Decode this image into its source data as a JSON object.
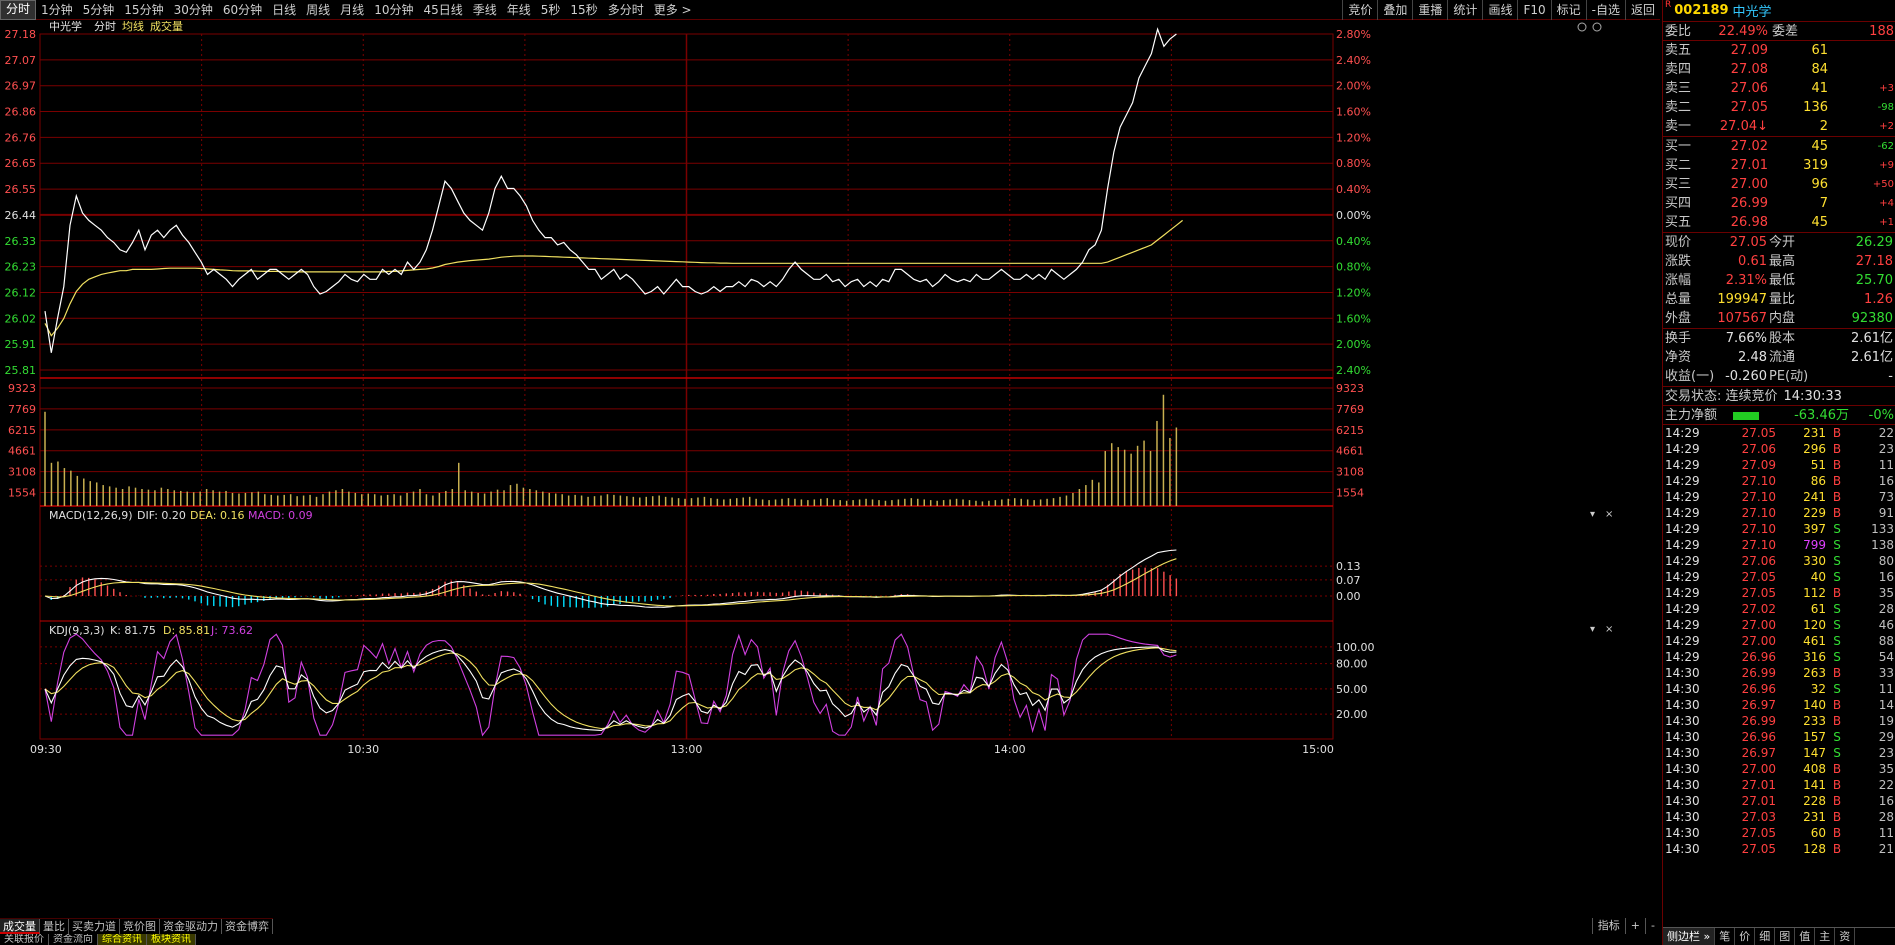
{
  "topbar": {
    "tabs": [
      "分时",
      "1分钟",
      "5分钟",
      "15分钟",
      "30分钟",
      "60分钟",
      "日线",
      "周线",
      "月线",
      "10分钟",
      "45日线",
      "季线",
      "年线",
      "5秒",
      "15秒",
      "多分时",
      "更多 >"
    ],
    "right": [
      "竞价",
      "叠加",
      "重播",
      "统计",
      "画线",
      "F10",
      "标记",
      "-自选",
      "返回"
    ]
  },
  "chart": {
    "legend": {
      "name": "中光学",
      "mode": "分时",
      "avg": "均线",
      "vol": "成交量"
    },
    "price_ticks": [
      "27.18",
      "27.07",
      "26.97",
      "26.86",
      "26.76",
      "26.65",
      "26.55",
      "26.44",
      "26.33",
      "26.23",
      "26.12",
      "26.02",
      "25.91",
      "25.81"
    ],
    "pct_ticks": [
      "2.80%",
      "2.40%",
      "2.00%",
      "1.60%",
      "1.20%",
      "0.80%",
      "0.40%",
      "0.00%",
      "0.40%",
      "0.80%",
      "1.20%",
      "1.60%",
      "2.00%",
      "2.40%"
    ],
    "vol_ticks": [
      "9323",
      "7769",
      "6215",
      "4661",
      "3108",
      "1554"
    ],
    "macd_label": "MACD(12,26,9)",
    "macd_dif": "DIF: 0.20",
    "macd_dea": "DEA: 0.16",
    "macd_val": "MACD: 0.09",
    "macd_ticks": [
      "0.13",
      "0.07",
      "0.00"
    ],
    "kdj_label": "KDJ(9,3,3)",
    "kdj_k": "K: 81.75",
    "kdj_d": "D: 85.81",
    "kdj_j": "J: 73.62",
    "kdj_ticks": [
      "100.00",
      "80.00",
      "50.00",
      "20.00"
    ],
    "time_ticks": [
      "09:30",
      "10:30",
      "13:00",
      "14:00",
      "15:00"
    ],
    "colors": {
      "grid": "#7a0000",
      "price": "#ffffff",
      "avg": "#f0e060",
      "red": "#ff5050",
      "green": "#00e0ff",
      "vol": "#c8b050",
      "dif": "#ffffff",
      "dea": "#f0e060",
      "kdj_k": "#ffffff",
      "kdj_d": "#f0e060",
      "kdj_j": "#d040e0"
    }
  },
  "chart_data": {
    "type": "line",
    "title": "中光学 分时",
    "xlabel": "",
    "ylabel": "",
    "x_ticks": [
      "09:30",
      "10:30",
      "13:00",
      "14:00",
      "15:00"
    ],
    "price_range": [
      25.81,
      27.18
    ],
    "prev_close": 26.44,
    "series": [
      {
        "name": "分时",
        "values": [
          26.05,
          25.88,
          26.02,
          26.15,
          26.4,
          26.52,
          26.45,
          26.42,
          26.4,
          26.38,
          26.35,
          26.33,
          26.3,
          26.29,
          26.33,
          26.38,
          26.3,
          26.36,
          26.38,
          26.35,
          26.38,
          26.4,
          26.36,
          26.33,
          26.29,
          26.25,
          26.2,
          26.22,
          26.2,
          26.18,
          26.15,
          26.18,
          26.2,
          26.22,
          26.18,
          26.2,
          26.22,
          26.22,
          26.2,
          26.18,
          26.2,
          26.22,
          26.2,
          26.15,
          26.12,
          26.13,
          26.15,
          26.17,
          26.2,
          26.18,
          26.17,
          26.2,
          26.18,
          26.18,
          26.22,
          26.2,
          26.22,
          26.2,
          26.25,
          26.22,
          26.25,
          26.3,
          26.38,
          26.48,
          26.58,
          26.55,
          26.5,
          26.45,
          26.42,
          26.4,
          26.38,
          26.45,
          26.55,
          26.6,
          26.55,
          26.55,
          26.52,
          26.48,
          26.42,
          26.38,
          26.35,
          26.35,
          26.32,
          26.33,
          26.3,
          26.28,
          26.25,
          26.22,
          26.22,
          26.18,
          26.2,
          26.22,
          26.18,
          26.2,
          26.18,
          26.15,
          26.12,
          26.13,
          26.15,
          26.12,
          26.15,
          26.18,
          26.15,
          26.15,
          26.13,
          26.12,
          26.13,
          26.15,
          26.13,
          26.15,
          26.15,
          26.17,
          26.15,
          26.18,
          26.17,
          26.15,
          26.17,
          26.15,
          26.18,
          26.22,
          26.25,
          26.22,
          26.2,
          26.18,
          26.18,
          26.2,
          26.17,
          26.18,
          26.15,
          26.17,
          26.18,
          26.15,
          26.17,
          26.15,
          26.18,
          26.17,
          26.22,
          26.22,
          26.2,
          26.18,
          26.17,
          26.18,
          26.15,
          26.17,
          26.2,
          26.18,
          26.17,
          26.18,
          26.17,
          26.2,
          26.18,
          26.18,
          26.2,
          26.22,
          26.2,
          26.18,
          26.18,
          26.2,
          26.18,
          26.2,
          26.18,
          26.22,
          26.2,
          26.18,
          26.2,
          26.22,
          26.25,
          26.3,
          26.32,
          26.38,
          26.55,
          26.7,
          26.8,
          26.85,
          26.9,
          27.0,
          27.05,
          27.1,
          27.2,
          27.13,
          27.16,
          27.18
        ]
      },
      {
        "name": "均线",
        "values": [
          26.0,
          25.95,
          25.98,
          26.02,
          26.08,
          26.13,
          26.16,
          26.18,
          26.19,
          26.2,
          26.205,
          26.21,
          26.215,
          26.215,
          26.22,
          26.22,
          26.22,
          26.22,
          26.222,
          26.224,
          26.225,
          26.225,
          26.225,
          26.225,
          26.225,
          26.224,
          26.222,
          26.22,
          26.218,
          26.217,
          26.215,
          26.214,
          26.214,
          26.214,
          26.213,
          26.212,
          26.212,
          26.212,
          26.211,
          26.21,
          26.21,
          26.21,
          26.21,
          26.21,
          26.21,
          26.21,
          26.21,
          26.21,
          26.21,
          26.21,
          26.21,
          26.21,
          26.21,
          26.21,
          26.21,
          26.212,
          26.212,
          26.214,
          26.216,
          26.218,
          26.22,
          26.222,
          26.226,
          26.232,
          26.24,
          26.245,
          26.25,
          26.253,
          26.256,
          26.258,
          26.26,
          26.262,
          26.266,
          26.27,
          26.272,
          26.274,
          26.275,
          26.275,
          26.275,
          26.274,
          26.273,
          26.272,
          26.271,
          26.27,
          26.269,
          26.268,
          26.267,
          26.266,
          26.265,
          26.264,
          26.263,
          26.262,
          26.261,
          26.26,
          26.259,
          26.258,
          26.257,
          26.256,
          26.255,
          26.254,
          26.253,
          26.252,
          26.251,
          26.25,
          26.249,
          26.248,
          26.247,
          26.247,
          26.246,
          26.246,
          26.245,
          26.245,
          26.245,
          26.245,
          26.245,
          26.245,
          26.245,
          26.245,
          26.245,
          26.245,
          26.245,
          26.245,
          26.245,
          26.245,
          26.245,
          26.245,
          26.245,
          26.245,
          26.245,
          26.245,
          26.245,
          26.245,
          26.245,
          26.245,
          26.245,
          26.245,
          26.245,
          26.245,
          26.245,
          26.245,
          26.245,
          26.245,
          26.245,
          26.245,
          26.245,
          26.245,
          26.245,
          26.245,
          26.245,
          26.245,
          26.245,
          26.245,
          26.245,
          26.245,
          26.245,
          26.245,
          26.245,
          26.245,
          26.245,
          26.245,
          26.245,
          26.245,
          26.245,
          26.245,
          26.245,
          26.245,
          26.245,
          26.245,
          26.245,
          26.245,
          26.25,
          26.26,
          26.27,
          26.28,
          26.29,
          26.3,
          26.31,
          26.32,
          26.34,
          26.36,
          26.38,
          26.4,
          26.42
        ]
      }
    ],
    "volume": {
      "range": [
        0,
        9323
      ],
      "values": [
        7200,
        3300,
        3400,
        2900,
        2700,
        2300,
        2100,
        1900,
        1800,
        1600,
        1500,
        1400,
        1300,
        1500,
        1400,
        1300,
        1250,
        1200,
        1400,
        1300,
        1200,
        1150,
        1100,
        1050,
        1100,
        1300,
        1200,
        1100,
        1150,
        1000,
        950,
        1000,
        1050,
        1100,
        900,
        850,
        800,
        850,
        900,
        750,
        800,
        850,
        700,
        900,
        1100,
        1200,
        1300,
        1100,
        1000,
        900,
        950,
        900,
        800,
        850,
        900,
        800,
        1000,
        1100,
        1300,
        900,
        800,
        1000,
        1150,
        1300,
        3300,
        1200,
        1100,
        1000,
        950,
        1100,
        1250,
        1200,
        1600,
        1700,
        1400,
        1300,
        1200,
        1100,
        1000,
        950,
        900,
        800,
        850,
        800,
        700,
        750,
        800,
        900,
        850,
        800,
        750,
        700,
        650,
        700,
        750,
        800,
        700,
        650,
        600,
        550,
        600,
        650,
        700,
        600,
        550,
        500,
        550,
        600,
        650,
        700,
        550,
        500,
        450,
        500,
        550,
        600,
        550,
        500,
        450,
        500,
        550,
        600,
        500,
        450,
        400,
        450,
        500,
        550,
        500,
        450,
        400,
        450,
        500,
        550,
        600,
        550,
        500,
        450,
        400,
        450,
        500,
        550,
        500,
        450,
        400,
        350,
        400,
        450,
        500,
        550,
        600,
        550,
        500,
        450,
        500,
        550,
        600,
        700,
        800,
        1000,
        1300,
        1600,
        2000,
        1800,
        4200,
        4800,
        4500,
        4300,
        4000,
        4600,
        5000,
        4200,
        6500,
        8500,
        5200,
        6000
      ]
    },
    "macd": {
      "dif": 0.2,
      "dea": 0.16,
      "macd": 0.09
    },
    "kdj": {
      "k": 81.75,
      "d": 85.81,
      "j": 73.62
    }
  },
  "panel": {
    "r": "R",
    "code": "002189",
    "name": "中光学",
    "weibi": {
      "l1": "委比",
      "v1": "22.49%",
      "l2": "委差",
      "v2": "188"
    },
    "sells": [
      {
        "l": "卖五",
        "p": "27.09",
        "v": "61",
        "c": ""
      },
      {
        "l": "卖四",
        "p": "27.08",
        "v": "84",
        "c": ""
      },
      {
        "l": "卖三",
        "p": "27.06",
        "v": "41",
        "c": "+3"
      },
      {
        "l": "卖二",
        "p": "27.05",
        "v": "136",
        "c": "-98"
      },
      {
        "l": "卖一",
        "p": "27.04↓",
        "v": "2",
        "c": "+2"
      }
    ],
    "buys": [
      {
        "l": "买一",
        "p": "27.02",
        "v": "45",
        "c": "-62"
      },
      {
        "l": "买二",
        "p": "27.01",
        "v": "319",
        "c": "+9"
      },
      {
        "l": "买三",
        "p": "27.00",
        "v": "96",
        "c": "+50"
      },
      {
        "l": "买四",
        "p": "26.99",
        "v": "7",
        "c": "+4"
      },
      {
        "l": "买五",
        "p": "26.98",
        "v": "45",
        "c": "+1"
      }
    ],
    "quote1": [
      {
        "l1": "现价",
        "v1": "27.05",
        "c1": "red",
        "l2": "今开",
        "v2": "26.29",
        "c2": "grn"
      },
      {
        "l1": "涨跌",
        "v1": "0.61",
        "c1": "red",
        "l2": "最高",
        "v2": "27.18",
        "c2": "red"
      },
      {
        "l1": "涨幅",
        "v1": "2.31%",
        "c1": "red",
        "l2": "最低",
        "v2": "25.70",
        "c2": "grn"
      },
      {
        "l1": "总量",
        "v1": "199947",
        "c1": "yel",
        "l2": "量比",
        "v2": "1.26",
        "c2": "red"
      },
      {
        "l1": "外盘",
        "v1": "107567",
        "c1": "red",
        "l2": "内盘",
        "v2": "92380",
        "c2": "grn"
      }
    ],
    "quote2": [
      {
        "l1": "换手",
        "v1": "7.66%",
        "l2": "股本",
        "v2": "2.61亿"
      },
      {
        "l1": "净资",
        "v1": "2.48",
        "l2": "流通",
        "v2": "2.61亿"
      },
      {
        "l1": "收益(一)",
        "v1": "-0.260",
        "l2": "PE(动)",
        "v2": "-"
      }
    ],
    "status_label": "交易状态: 连续竞价",
    "status_time": "14:30:33",
    "netflow_label": "主力净额",
    "netflow_value": "-63.46万",
    "netflow_pct": "-0%",
    "ticks": [
      {
        "t": "14:29",
        "p": "27.05",
        "v": "231",
        "bs": "B",
        "n": "22"
      },
      {
        "t": "14:29",
        "p": "27.06",
        "v": "296",
        "bs": "B",
        "n": "23"
      },
      {
        "t": "14:29",
        "p": "27.09",
        "v": "51",
        "bs": "B",
        "n": "11"
      },
      {
        "t": "14:29",
        "p": "27.10",
        "v": "86",
        "bs": "B",
        "n": "16"
      },
      {
        "t": "14:29",
        "p": "27.10",
        "v": "241",
        "bs": "B",
        "n": "73"
      },
      {
        "t": "14:29",
        "p": "27.10",
        "v": "229",
        "bs": "B",
        "n": "91"
      },
      {
        "t": "14:29",
        "p": "27.10",
        "v": "397",
        "bs": "S",
        "n": "133"
      },
      {
        "t": "14:29",
        "p": "27.10",
        "v": "799",
        "bs": "S",
        "n": "138"
      },
      {
        "t": "14:29",
        "p": "27.06",
        "v": "330",
        "bs": "S",
        "n": "80"
      },
      {
        "t": "14:29",
        "p": "27.05",
        "v": "40",
        "bs": "S",
        "n": "16"
      },
      {
        "t": "14:29",
        "p": "27.05",
        "v": "112",
        "bs": "B",
        "n": "35"
      },
      {
        "t": "14:29",
        "p": "27.02",
        "v": "61",
        "bs": "S",
        "n": "28"
      },
      {
        "t": "14:29",
        "p": "27.00",
        "v": "120",
        "bs": "S",
        "n": "46"
      },
      {
        "t": "14:29",
        "p": "27.00",
        "v": "461",
        "bs": "S",
        "n": "88"
      },
      {
        "t": "14:29",
        "p": "26.96",
        "v": "316",
        "bs": "S",
        "n": "54"
      },
      {
        "t": "14:30",
        "p": "26.99",
        "v": "263",
        "bs": "B",
        "n": "33"
      },
      {
        "t": "14:30",
        "p": "26.96",
        "v": "32",
        "bs": "S",
        "n": "11"
      },
      {
        "t": "14:30",
        "p": "26.97",
        "v": "140",
        "bs": "B",
        "n": "14"
      },
      {
        "t": "14:30",
        "p": "26.99",
        "v": "233",
        "bs": "B",
        "n": "19"
      },
      {
        "t": "14:30",
        "p": "26.96",
        "v": "157",
        "bs": "S",
        "n": "29"
      },
      {
        "t": "14:30",
        "p": "26.97",
        "v": "147",
        "bs": "S",
        "n": "23"
      },
      {
        "t": "14:30",
        "p": "27.00",
        "v": "408",
        "bs": "B",
        "n": "35"
      },
      {
        "t": "14:30",
        "p": "27.01",
        "v": "141",
        "bs": "B",
        "n": "22"
      },
      {
        "t": "14:30",
        "p": "27.01",
        "v": "228",
        "bs": "B",
        "n": "16"
      },
      {
        "t": "14:30",
        "p": "27.03",
        "v": "231",
        "bs": "B",
        "n": "28"
      },
      {
        "t": "14:30",
        "p": "27.05",
        "v": "60",
        "bs": "B",
        "n": "11"
      },
      {
        "t": "14:30",
        "p": "27.05",
        "v": "128",
        "bs": "B",
        "n": "21"
      }
    ],
    "bottom_tabs": [
      "侧边栏 »",
      "笔",
      "价",
      "细",
      "图",
      "值",
      "主",
      "资"
    ]
  },
  "bottom": {
    "tabs1": [
      "成交量",
      "量比",
      "买卖力道",
      "竞价图",
      "资金驱动力",
      "资金博弈"
    ],
    "tabs2": [
      "关联报价",
      "资金流向",
      "综合资讯",
      "板块资讯"
    ],
    "right": [
      "指标",
      "+",
      "-"
    ]
  }
}
